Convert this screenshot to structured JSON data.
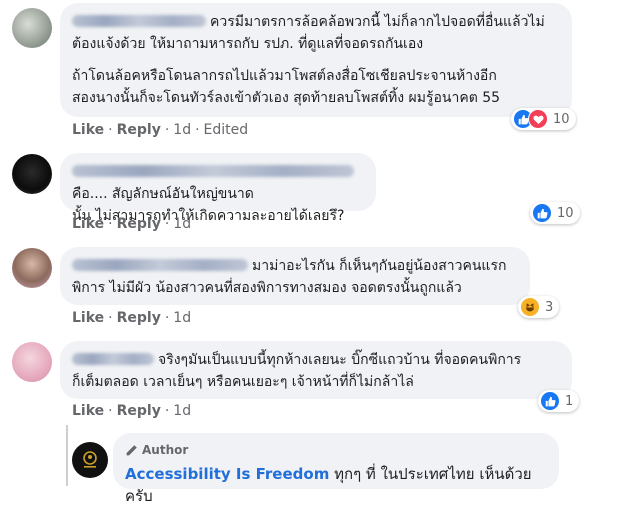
{
  "colors": {
    "like_blue": "#1877f2",
    "love_red": "#f33e58",
    "haha_yellow": "#f7b125",
    "author_blue": "#216fdb"
  },
  "comments": [
    {
      "text_lines": [
        "ควรมีมาตรการล้อคล้อพวกนี้ ไม่ก็ลากไปจอดที่อื่นแล้วไม่",
        "ต้องแจ้งด้วย ให้มาถามหารถกับ รปภ. ที่ดูแลที่จอดรถกันเอง"
      ],
      "text_lines_2": [
        "ถ้าโดนล้อคหรือโดนลากรถไปแล้วมาโพสต์ลงสื่อโซเชียลประจานห้างอีก",
        "สองนางนั้นก็จะโดนทัวร์ลงเข้าตัวเอง สุดท้ายลบโพสต์ทิ้ง ผมรู้อนาคต 55"
      ],
      "like": "Like",
      "reply": "Reply",
      "time": "1d",
      "edited": "Edited",
      "reaction_icons": [
        "like-icon",
        "love-icon"
      ],
      "reaction_count": "10"
    },
    {
      "text_lines": [
        "คือ.... สัญลักษณ์อันใหญ่ขนาด",
        "นั้น ไม่สามารถทำให้เกิดความละอายได้เลยรึ?"
      ],
      "like": "Like",
      "reply": "Reply",
      "time": "1d",
      "reaction_icons": [
        "like-icon"
      ],
      "reaction_count": "10"
    },
    {
      "text_lines": [
        "มาม่าอะไรกัน ก็เห็นๆกันอยู่น้องสาวคนแรก",
        "พิการ ไม่มีผัว น้องสาวคนที่สองพิการทางสมอง จอดตรงนั้นถูกแล้ว"
      ],
      "like": "Like",
      "reply": "Reply",
      "time": "1d",
      "reaction_icons": [
        "haha-icon"
      ],
      "reaction_count": "3"
    },
    {
      "text_lines": [
        "จริงๆมันเป็นแบบนี้ทุกห้างเลยนะ บิ๊กซีแถวบ้าน ที่จอดคนพิการ",
        "ก็เต็มตลอด เวลาเย็นๆ หรือคนเยอะๆ เจ้าหน้าที่ก็ไม่กล้าไล่"
      ],
      "like": "Like",
      "reply": "Reply",
      "time": "1d",
      "reaction_icons": [
        "like-icon"
      ],
      "reaction_count": "1"
    }
  ],
  "reply": {
    "badge_icon": "pencil-icon",
    "badge": "Author",
    "author": "Accessibility Is Freedom",
    "text": "ทุกๆ ที่ ในประเทศไทย เห็นด้วยครับ"
  }
}
